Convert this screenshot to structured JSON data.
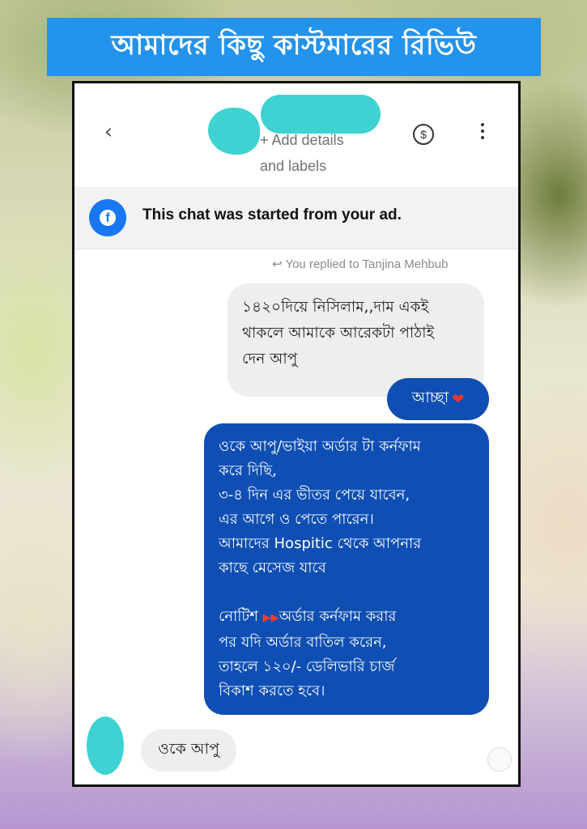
{
  "banner": {
    "title": "আমাদের কিছু কাস্টমারের রিভিউ"
  },
  "header": {
    "back_icon": "‹",
    "add_details_line1": "+ Add details",
    "add_details_line2": "and labels",
    "dollar_icon": "$"
  },
  "ad_notice": {
    "icon": "f",
    "text": "This chat was started from your ad."
  },
  "reply_note": "↩ You replied to Tanjina Mehbub",
  "messages": {
    "quoted": {
      "line1": "১৪২০দিয়ে নিসিলাম,,দাম একই",
      "line2": "থাকলে আমাকে আরেকটা পাঠাই",
      "line3": "দেন আপু"
    },
    "reply_short": {
      "text": "আচ্ছা",
      "emoji": "❤"
    },
    "reply_long": {
      "l1": "ওকে আপু/ভাইয়া অর্ডার টা কর্নফাম",
      "l2": "করে দিছি,",
      "l3": " ৩-৪ দিন এর ভীতর পেয়ে যাবেন,",
      "l4": "এর আগে ও পেতে পারেন।",
      "l5": "আমাদের Hospitic থেকে আপনার",
      "l6": "কাছে মেসেজ যাবে",
      "l7_prefix": " নোটিশ ",
      "flags": "▶▶",
      "l7_suffix": "অর্ডার কর্নফাম করার",
      "l8": "পর যদি অর্ডার বাতিল করেন,",
      "l9": "তাহলে ১২০/- ডেলিভারি চার্জ",
      "l10": "বিকাশ করতে হবে।"
    },
    "incoming": {
      "text": "ওকে আপু"
    }
  },
  "colors": {
    "banner": "#2393ec",
    "bubble_blue": "#0f4fb3",
    "bubble_grey": "#eeeeef",
    "redaction": "#3fd2d2",
    "facebook": "#1877f2"
  }
}
